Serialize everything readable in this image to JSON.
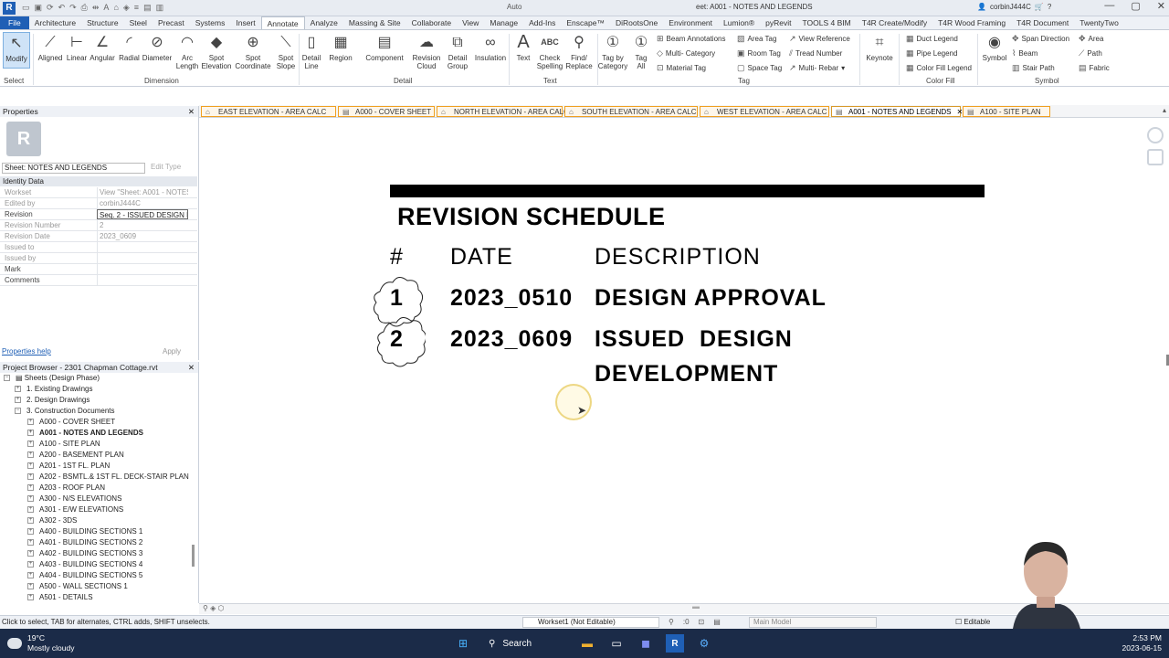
{
  "titlebar": {
    "app_left": "Auto",
    "doc_title": "eet: A001 - NOTES AND LEGENDS",
    "user": "corbinJ444C"
  },
  "ribbon_tabs": [
    "File",
    "Architecture",
    "Structure",
    "Steel",
    "Precast",
    "Systems",
    "Insert",
    "Annotate",
    "Analyze",
    "Massing & Site",
    "Collaborate",
    "View",
    "Manage",
    "Add-Ins",
    "Enscape™",
    "DiRootsOne",
    "Environment",
    "Lumion®",
    "pyRevit",
    "TOOLS 4 BIM",
    "T4R Create/Modify",
    "T4R Wood Framing",
    "T4R Document",
    "TwentyTwo"
  ],
  "active_ribbon_tab": "Annotate",
  "ribbon": {
    "select": {
      "modify": "Modify",
      "panel": "Select"
    },
    "dimension": {
      "aligned": "Aligned",
      "linear": "Linear",
      "angular": "Angular",
      "radial": "Radial",
      "diameter": "Diameter",
      "arc_length": "Arc Length",
      "spot_elevation": "Spot Elevation",
      "spot_coordinate": "Spot Coordinate",
      "spot_slope": "Spot Slope",
      "panel": "Dimension"
    },
    "detail": {
      "detail_line": "Detail Line",
      "region": "Region",
      "component": "Component",
      "revision_cloud": "Revision Cloud",
      "detail_group": "Detail Group",
      "insulation": "Insulation",
      "panel": "Detail"
    },
    "text": {
      "text": "Text",
      "check_spelling": "Check Spelling",
      "find_replace": "Find/ Replace",
      "panel": "Text"
    },
    "tag": {
      "tag_by_category": "Tag by Category",
      "tag_all": "Tag All",
      "beam_annotations": "Beam Annotations",
      "multi_category": "Multi- Category",
      "material_tag": "Material Tag",
      "area_tag": "Area Tag",
      "room_tag": "Room Tag",
      "space_tag": "Space Tag",
      "view_reference": "View Reference",
      "tread_number": "Tread Number",
      "multi_rebar": "Multi- Rebar",
      "panel": "Tag"
    },
    "keynote": "Keynote",
    "color_fill": {
      "duct_legend": "Duct Legend",
      "pipe_legend": "Pipe Legend",
      "color_fill_legend": "Color Fill Legend",
      "panel": "Color Fill"
    },
    "symbol": {
      "symbol": "Symbol",
      "span_direction": "Span Direction",
      "beam": "Beam",
      "stair_path": "Stair Path",
      "area": "Area",
      "path": "Path",
      "fabric": "Fabric",
      "panel": "Symbol"
    }
  },
  "properties": {
    "header": "Properties",
    "type_selector": "Sheet: NOTES AND LEGENDS",
    "edit_type": "Edit Type",
    "group": "Identity Data",
    "rows": [
      {
        "key": "Workset",
        "value": "View \"Sheet: A001 - NOTES..."
      },
      {
        "key": "Edited by",
        "value": "corbinJ444C"
      },
      {
        "key": "Revision",
        "value": "Seq. 2 - ISSUED DESIGN D"
      },
      {
        "key": "Revision Number",
        "value": "2"
      },
      {
        "key": "Revision Date",
        "value": "2023_0609"
      },
      {
        "key": "Issued to",
        "value": ""
      },
      {
        "key": "Issued by",
        "value": ""
      },
      {
        "key": "Mark",
        "value": ""
      },
      {
        "key": "Comments",
        "value": ""
      }
    ],
    "help": "Properties help",
    "apply": "Apply"
  },
  "browser": {
    "header": "Project Browser - 2301 Chapman Cottage.rvt",
    "root": "Sheets (Design Phase)",
    "groups": [
      "1. Existing Drawings",
      "2. Design Drawings",
      "3. Construction Documents"
    ],
    "sheets": [
      "A000 - COVER SHEET",
      "A001 - NOTES AND LEGENDS",
      "A100 - SITE PLAN",
      "A200 - BASEMENT PLAN",
      "A201 - 1ST FL. PLAN",
      "A202 - BSMTL.& 1ST FL. DECK-STAIR PLAN",
      "A203 - ROOF PLAN",
      "A300 - N/S ELEVATIONS",
      "A301 - E/W ELEVATIONS",
      "A302 - 3DS",
      "A400 - BUILDING SECTIONS 1",
      "A401 - BUILDING SECTIONS 2",
      "A402 - BUILDING SECTIONS 3",
      "A403 - BUILDING SECTIONS 4",
      "A404 - BUILDING SECTIONS 5",
      "A500 - WALL SECTIONS 1",
      "A501 - DETAILS"
    ]
  },
  "view_tabs": [
    "EAST ELEVATION - AREA CALC",
    "A000 - COVER SHEET",
    "NORTH ELEVATION - AREA CALC",
    "SOUTH ELEVATION - AREA CALC",
    "WEST ELEVATION - AREA CALC",
    "A001 - NOTES AND LEGENDS",
    "A100 - SITE PLAN"
  ],
  "schedule": {
    "title": "REVISION SCHEDULE",
    "headers": {
      "num": "#",
      "date": "DATE",
      "desc": "DESCRIPTION"
    },
    "rows": [
      {
        "num": "1",
        "date": "2023_0510",
        "desc_line1": "DESIGN APPROVAL",
        "desc_line2": ""
      },
      {
        "num": "2",
        "date": "2023_0609",
        "desc_line1": "ISSUED  DESIGN",
        "desc_line2": "DEVELOPMENT"
      }
    ]
  },
  "status": {
    "hint": "Click to select, TAB for alternates, CTRL adds, SHIFT unselects.",
    "workset": "Workset1 (Not Editable)",
    "filter_count": ":0",
    "design_option": "Main Model",
    "editable": "Editable"
  },
  "taskbar": {
    "temp": "19°C",
    "weather": "Mostly cloudy",
    "search": "Search",
    "time": "2:53 PM",
    "date": "2023-06-15"
  }
}
